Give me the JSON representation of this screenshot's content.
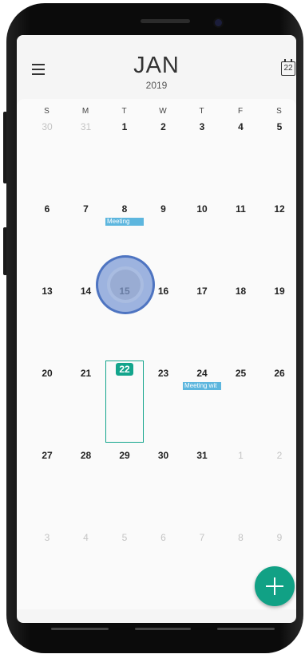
{
  "header": {
    "month": "JAN",
    "year": "2019",
    "today_icon_label": "22"
  },
  "weekdays": [
    "S",
    "M",
    "T",
    "W",
    "T",
    "F",
    "S"
  ],
  "weeks": [
    [
      "30",
      "31",
      "1",
      "2",
      "3",
      "4",
      "5"
    ],
    [
      "6",
      "7",
      "8",
      "9",
      "10",
      "11",
      "12"
    ],
    [
      "13",
      "14",
      "15",
      "16",
      "17",
      "18",
      "19"
    ],
    [
      "20",
      "21",
      "22",
      "23",
      "24",
      "25",
      "26"
    ],
    [
      "27",
      "28",
      "29",
      "30",
      "31",
      "1",
      "2"
    ],
    [
      "3",
      "4",
      "5",
      "6",
      "7",
      "8",
      "9"
    ]
  ],
  "events": [
    {
      "title": "Meeting",
      "date": "8"
    },
    {
      "title": "Meeting wit",
      "date": "24"
    }
  ],
  "selected_date": "22",
  "colors": {
    "accent": "#13a58c",
    "event": "#5db6de",
    "fab": "#11a185"
  },
  "icons": {
    "menu": "hamburger-menu-icon",
    "today": "calendar-today-icon",
    "add": "plus-icon"
  }
}
